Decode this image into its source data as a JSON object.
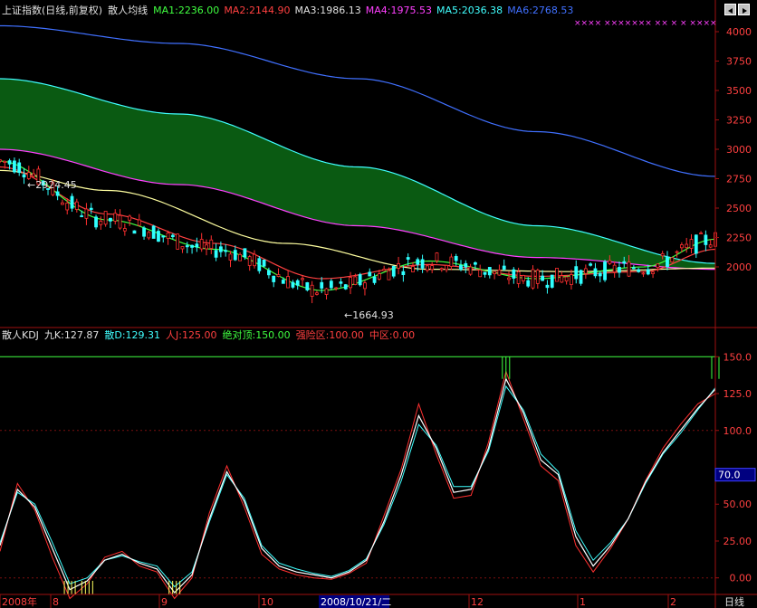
{
  "top_legend": [
    {
      "text": "上证指数(日线,前复权)",
      "color": "#e0e0e0"
    },
    {
      "text": "散人均线",
      "color": "#e0e0e0"
    },
    {
      "text": "MA1:2236.00",
      "color": "#40ff40"
    },
    {
      "text": "MA2:2144.90",
      "color": "#ff4040"
    },
    {
      "text": "MA3:1986.13",
      "color": "#e0e0e0"
    },
    {
      "text": "MA4:1975.53",
      "color": "#ff40ff"
    },
    {
      "text": "MA5:2036.38",
      "color": "#40ffff"
    },
    {
      "text": "MA6:2768.53",
      "color": "#4070ff"
    }
  ],
  "marker_row": "××××  ×××××××  ××  × ×  ××××",
  "price_axis": [
    "4000",
    "3750",
    "3500",
    "3250",
    "3000",
    "2750",
    "2500",
    "2250",
    "2000"
  ],
  "annotations": {
    "high": "←2924.45",
    "low": "←1664.93"
  },
  "kdj_legend": [
    {
      "text": "散人KDJ",
      "color": "#e0e0e0"
    },
    {
      "text": "九K:127.87",
      "color": "#e0e0e0"
    },
    {
      "text": "散D:129.31",
      "color": "#40ffff"
    },
    {
      "text": "人J:125.00",
      "color": "#ff4040"
    },
    {
      "text": "绝对顶:150.00",
      "color": "#40ff40"
    },
    {
      "text": "强险区:100.00",
      "color": "#ff4040"
    },
    {
      "text": "中区:0.00",
      "color": "#ff4040"
    }
  ],
  "kdj_axis": [
    "150.0",
    "125.0",
    "100.0",
    "50.00",
    "25.00",
    "0.00"
  ],
  "kdj_cursor_value": "70.0",
  "date_axis": {
    "labels": [
      "2008年",
      "8",
      "9",
      "10",
      "12",
      "1",
      "2"
    ],
    "highlight": "2008/10/21/二",
    "period_label": "日线"
  },
  "colors": {
    "grid": "#7a1010",
    "axis": "#a01010",
    "up": "#ff3030",
    "down": "#30ffff",
    "ma1": "#40ff40",
    "ma2": "#ff4040",
    "ma3": "#ffffa0",
    "ma4": "#ff40ff",
    "ma5": "#40ffff",
    "ma6": "#4070ff",
    "band": "#0a5a12"
  },
  "chart_data": {
    "type": "line",
    "price": {
      "ylim": [
        1500,
        4100
      ],
      "MA6": {
        "x": [
          0,
          0.25,
          0.5,
          0.75,
          1
        ],
        "y": [
          4050,
          3900,
          3600,
          3150,
          2770
        ]
      },
      "MA5": {
        "x": [
          0,
          0.25,
          0.5,
          0.75,
          1
        ],
        "y": [
          3600,
          3300,
          2850,
          2350,
          2030
        ]
      },
      "MA4": {
        "x": [
          0,
          0.25,
          0.5,
          0.75,
          1
        ],
        "y": [
          3000,
          2700,
          2350,
          2080,
          1980
        ]
      },
      "MA3": {
        "x": [
          0,
          0.15,
          0.4,
          0.6,
          0.8,
          1
        ],
        "y": [
          2820,
          2650,
          2200,
          1980,
          1960,
          1990
        ]
      },
      "MA2": {
        "x": [
          0,
          0.15,
          0.3,
          0.45,
          0.6,
          0.75,
          0.9,
          1
        ],
        "y": [
          2850,
          2450,
          2200,
          1900,
          2020,
          1920,
          1960,
          2150
        ]
      },
      "MA1": {
        "x": [
          0,
          0.15,
          0.3,
          0.45,
          0.6,
          0.75,
          0.9,
          1
        ],
        "y": [
          2900,
          2400,
          2150,
          1800,
          2050,
          1900,
          2000,
          2236
        ]
      }
    },
    "kdj": {
      "ylim": [
        -10,
        160
      ],
      "K": [
        22,
        60,
        48,
        20,
        -8,
        -2,
        12,
        16,
        10,
        6,
        -10,
        2,
        40,
        72,
        52,
        20,
        8,
        4,
        2,
        0,
        4,
        12,
        38,
        70,
        110,
        88,
        58,
        60,
        88,
        135,
        112,
        80,
        70,
        28,
        8,
        22,
        40,
        65,
        85,
        100,
        115,
        128
      ],
      "D": [
        24,
        58,
        50,
        24,
        -4,
        0,
        12,
        15,
        11,
        8,
        -6,
        4,
        38,
        70,
        54,
        22,
        10,
        6,
        3,
        1,
        5,
        13,
        36,
        66,
        104,
        90,
        62,
        62,
        86,
        130,
        114,
        84,
        72,
        32,
        12,
        24,
        40,
        64,
        84,
        98,
        114,
        129
      ],
      "J": [
        18,
        64,
        46,
        14,
        -14,
        -4,
        14,
        18,
        8,
        4,
        -14,
        0,
        44,
        76,
        48,
        16,
        6,
        2,
        0,
        -1,
        3,
        10,
        42,
        74,
        118,
        84,
        54,
        56,
        92,
        140,
        108,
        76,
        66,
        22,
        4,
        20,
        40,
        66,
        88,
        104,
        118,
        125
      ]
    }
  }
}
